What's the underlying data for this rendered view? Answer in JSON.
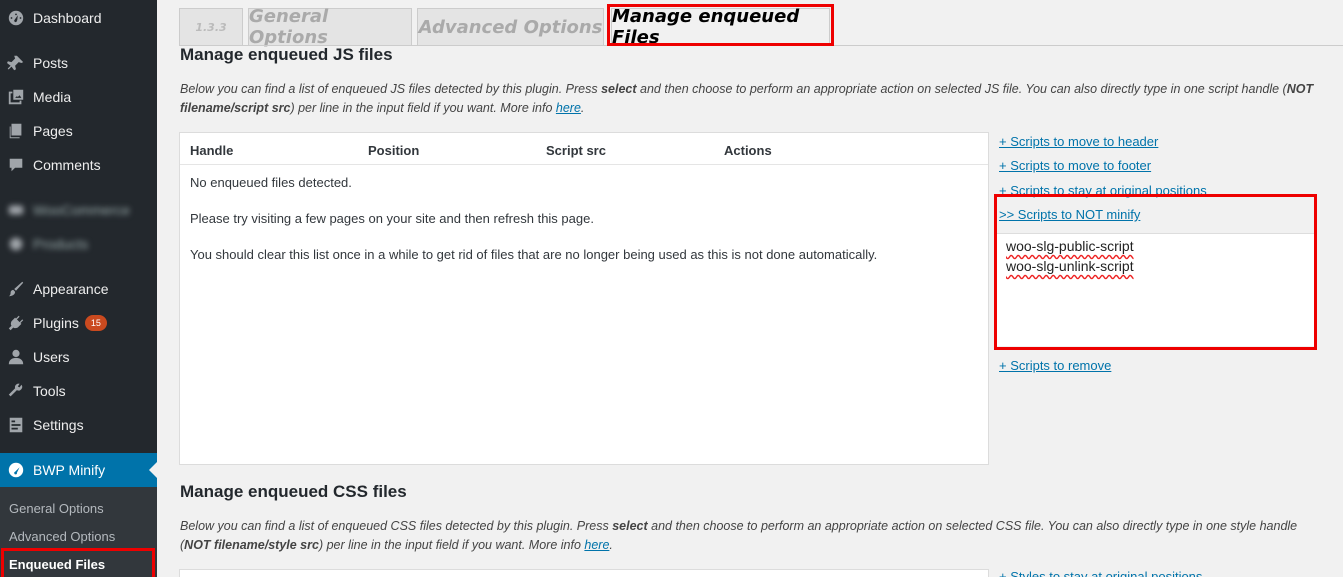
{
  "sidebar": {
    "items": [
      {
        "label": "Dashboard",
        "icon": "dashboard-icon"
      },
      {
        "label": "Posts",
        "icon": "pin-icon"
      },
      {
        "label": "Media",
        "icon": "media-icon"
      },
      {
        "label": "Pages",
        "icon": "pages-icon"
      },
      {
        "label": "Comments",
        "icon": "comments-icon"
      },
      {
        "label": "WooCommerce",
        "icon": "woocommerce-icon"
      },
      {
        "label": "Products",
        "icon": "products-icon"
      },
      {
        "label": "Appearance",
        "icon": "brush-icon"
      },
      {
        "label": "Plugins",
        "icon": "plugin-icon",
        "badge": "15"
      },
      {
        "label": "Users",
        "icon": "user-icon"
      },
      {
        "label": "Tools",
        "icon": "wrench-icon"
      },
      {
        "label": "Settings",
        "icon": "settings-icon"
      },
      {
        "label": "BWP Minify",
        "icon": "gauge-icon"
      }
    ],
    "submenu": [
      "General Options",
      "Advanced Options",
      "Enqueued Files"
    ]
  },
  "tabs": [
    "1.3.3",
    "General Options",
    "Advanced Options",
    "Manage enqueued Files"
  ],
  "js_section": {
    "title": "Manage enqueued JS files",
    "desc_1": "Below you can find a list of enqueued JS files detected by this plugin. Press ",
    "desc_bold_1": "select",
    "desc_2": " and then choose to perform an appropriate action on selected JS file. You can also directly type in one script handle (",
    "desc_bold_2": "NOT filename/script src",
    "desc_3": ") per line in the input field if you want. More info ",
    "desc_link": "here",
    "desc_end": ".",
    "columns": [
      "Handle",
      "Position",
      "Script src",
      "Actions"
    ],
    "messages": [
      "No enqueued files detected.",
      "Please try visiting a few pages on your site and then refresh this page.",
      "You should clear this list once in a while to get rid of files that are no longer being used as this is not done automatically."
    ],
    "links": {
      "header": "+ Scripts to move to header",
      "footer": "+ Scripts to move to footer",
      "original": "+ Scripts to stay at original positions",
      "not_minify": ">> Scripts to NOT minify",
      "remove": "+ Scripts to remove"
    },
    "not_minify_handles": [
      "woo-slg-public-script",
      "woo-slg-unlink-script"
    ]
  },
  "css_section": {
    "title": "Manage enqueued CSS files",
    "desc_1": "Below you can find a list of enqueued CSS files detected by this plugin. Press ",
    "desc_bold_1": "select",
    "desc_2": " and then choose to perform an appropriate action on selected CSS file. You can also directly type in one style handle (",
    "desc_bold_2": "NOT filename/style src",
    "desc_3": ") per line in the input field if you want. More info ",
    "desc_link": "here",
    "desc_end": ".",
    "link_original": "+ Styles to stay at original positions"
  },
  "colors": {
    "accent": "#0073aa",
    "highlight": "#ee0000",
    "sidebar": "#23282d"
  }
}
